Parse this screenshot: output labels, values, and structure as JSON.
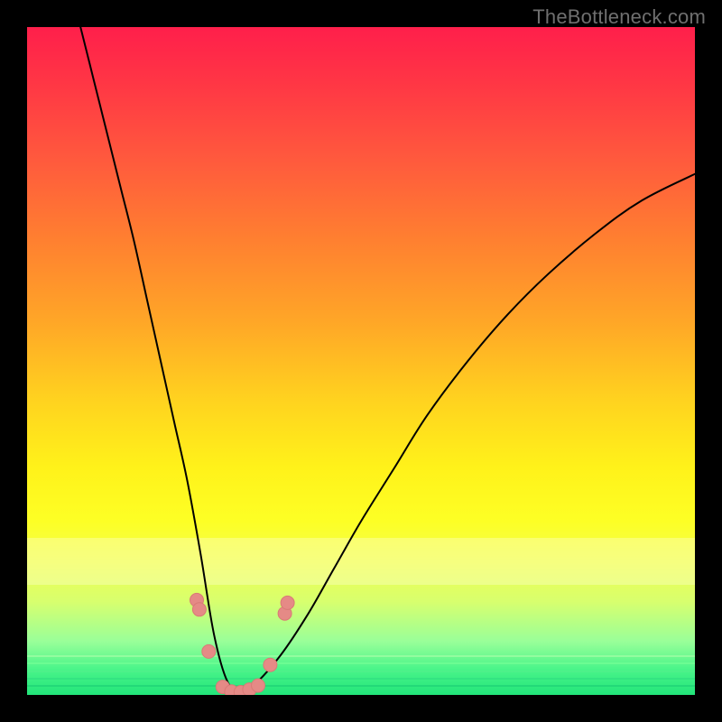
{
  "watermark": "TheBottleneck.com",
  "colors": {
    "frame": "#000000",
    "curve_stroke": "#000000",
    "marker_fill": "#e58a86",
    "marker_stroke": "#d97a76",
    "gradient_top": "#ff1f4b",
    "gradient_bottom": "#22e57a"
  },
  "chart_data": {
    "type": "line",
    "title": "",
    "xlabel": "",
    "ylabel": "",
    "xlim": [
      0,
      100
    ],
    "ylim": [
      0,
      100
    ],
    "grid": false,
    "legend": false,
    "note": "No numeric axis ticks or labels are shown; values are approximate relative positions (0-100) read from the image.",
    "series": [
      {
        "name": "bottleneck-curve",
        "x": [
          8,
          10,
          12,
          14,
          16,
          18,
          20,
          22,
          24,
          26,
          28,
          30,
          32,
          34,
          38,
          42,
          46,
          50,
          55,
          60,
          66,
          72,
          78,
          85,
          92,
          100
        ],
        "y": [
          100,
          92,
          84,
          76,
          68,
          59,
          50,
          41,
          32,
          21,
          9,
          2,
          0.5,
          1.5,
          6,
          12,
          19,
          26,
          34,
          42,
          50,
          57,
          63,
          69,
          74,
          78
        ]
      }
    ],
    "markers": [
      {
        "name": "marker-left-upper-a",
        "x": 25.4,
        "y": 14.2
      },
      {
        "name": "marker-left-upper-b",
        "x": 25.8,
        "y": 12.8
      },
      {
        "name": "marker-left-lower",
        "x": 27.2,
        "y": 6.5
      },
      {
        "name": "marker-valley-a",
        "x": 29.3,
        "y": 1.2
      },
      {
        "name": "marker-valley-b",
        "x": 30.6,
        "y": 0.5
      },
      {
        "name": "marker-valley-c",
        "x": 32.0,
        "y": 0.4
      },
      {
        "name": "marker-valley-d",
        "x": 33.3,
        "y": 0.8
      },
      {
        "name": "marker-valley-e",
        "x": 34.6,
        "y": 1.4
      },
      {
        "name": "marker-right-lower",
        "x": 36.4,
        "y": 4.5
      },
      {
        "name": "marker-right-upper-a",
        "x": 38.6,
        "y": 12.2
      },
      {
        "name": "marker-right-upper-b",
        "x": 39.0,
        "y": 13.8
      }
    ]
  }
}
